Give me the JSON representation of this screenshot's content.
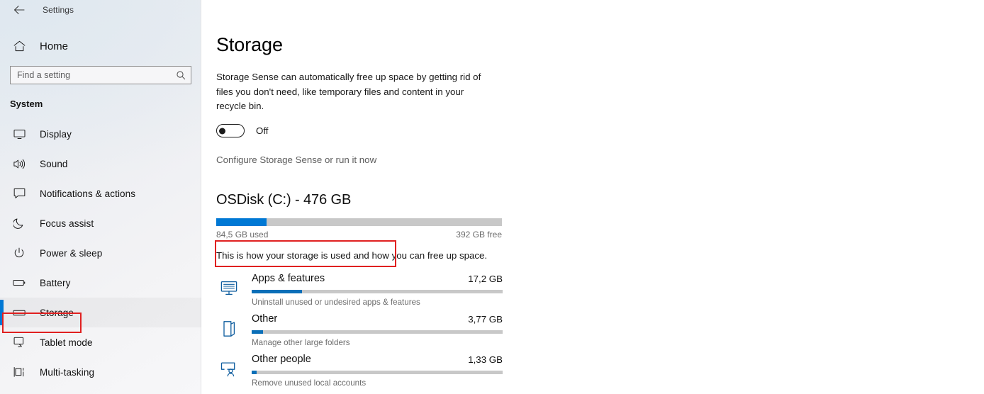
{
  "window": {
    "back_icon": "back-arrow-icon",
    "title": "Settings"
  },
  "sidebar": {
    "home": {
      "label": "Home",
      "icon": "home-icon"
    },
    "search": {
      "placeholder": "Find a setting",
      "value": "",
      "icon": "search-icon"
    },
    "group_heading": "System",
    "items": [
      {
        "label": "Display",
        "icon": "monitor-icon",
        "selected": false
      },
      {
        "label": "Sound",
        "icon": "speaker-icon",
        "selected": false
      },
      {
        "label": "Notifications & actions",
        "icon": "notification-icon",
        "selected": false
      },
      {
        "label": "Focus assist",
        "icon": "moon-icon",
        "selected": false
      },
      {
        "label": "Power & sleep",
        "icon": "power-icon",
        "selected": false
      },
      {
        "label": "Battery",
        "icon": "battery-icon",
        "selected": false
      },
      {
        "label": "Storage",
        "icon": "storage-drive-icon",
        "selected": true
      },
      {
        "label": "Tablet mode",
        "icon": "tablet-icon",
        "selected": false
      },
      {
        "label": "Multi-tasking",
        "icon": "multitasking-icon",
        "selected": false
      }
    ]
  },
  "main": {
    "page_title": "Storage",
    "intro": "Storage Sense can automatically free up space by getting rid of files you don't need, like temporary files and content in your recycle bin.",
    "storage_sense": {
      "state": "Off",
      "enabled": false
    },
    "configure_link": "Configure Storage Sense or run it now",
    "disk": {
      "title": "OSDisk (C:) - 476 GB",
      "used_label": "84,5 GB used",
      "free_label": "392 GB free",
      "used_percent": 17.5,
      "note": "This is how your storage is used and how you can free up space."
    },
    "categories": [
      {
        "name": "Apps & features",
        "size": "17,2 GB",
        "subtitle": "Uninstall unused or undesired apps & features",
        "percent": 20,
        "icon": "apps-monitor-icon"
      },
      {
        "name": "Other",
        "size": "3,77 GB",
        "subtitle": "Manage other large folders",
        "percent": 4.5,
        "icon": "folder-open-icon"
      },
      {
        "name": "Other people",
        "size": "1,33 GB",
        "subtitle": "Remove unused local accounts",
        "percent": 2,
        "icon": "other-people-icon"
      }
    ]
  },
  "annotations": {
    "storage_nav_highlight_color": "#e02020",
    "configure_link_highlight_color": "#e02020"
  },
  "colors": {
    "accent": "#0078d4",
    "bar_track": "#c8c8c8",
    "cat_icon": "#0d5c9e"
  }
}
